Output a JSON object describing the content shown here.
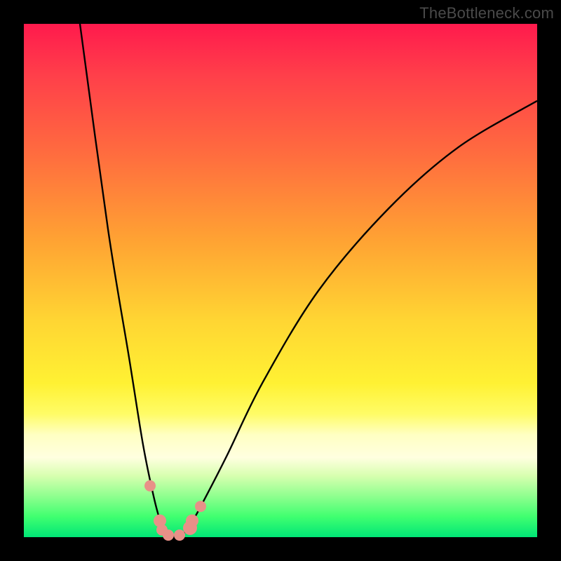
{
  "watermark": "TheBottleneck.com",
  "chart_data": {
    "type": "line",
    "title": "",
    "xlabel": "",
    "ylabel": "",
    "x_range": [
      0,
      732
    ],
    "y_range_percent": [
      0,
      100
    ],
    "curve": {
      "description": "bottleneck-like V curve: steep descent on left, flat minimum near x≈200-230, asymptotic rise toward right",
      "left_branch_x": [
        80,
        120,
        150,
        170,
        185,
        195,
        205
      ],
      "left_branch_y_pct": [
        100,
        60,
        35,
        18,
        8,
        3,
        0.5
      ],
      "right_branch_x": [
        225,
        240,
        260,
        290,
        340,
        420,
        520,
        620,
        732
      ],
      "right_branch_y_pct": [
        0.5,
        3,
        8,
        16,
        30,
        48,
        64,
        76,
        85
      ]
    },
    "markers": [
      {
        "x": 180,
        "y_pct": 10,
        "r": 8
      },
      {
        "x": 194,
        "y_pct": 3.2,
        "r": 9
      },
      {
        "x": 197,
        "y_pct": 1.4,
        "r": 8
      },
      {
        "x": 206,
        "y_pct": 0.4,
        "r": 8
      },
      {
        "x": 222,
        "y_pct": 0.4,
        "r": 8
      },
      {
        "x": 237,
        "y_pct": 1.8,
        "r": 10
      },
      {
        "x": 240,
        "y_pct": 3.2,
        "r": 9
      },
      {
        "x": 252,
        "y_pct": 6.0,
        "r": 8
      }
    ],
    "marker_color": "#e89088",
    "curve_color": "#000000"
  }
}
